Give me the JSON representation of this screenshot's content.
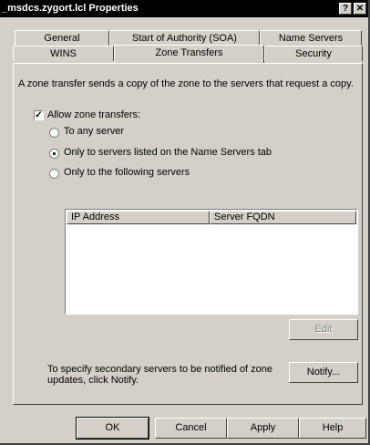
{
  "window": {
    "title": "_msdcs.zygort.lcl Properties",
    "help_label": "?",
    "close_label": "✕"
  },
  "tabs": {
    "row1": [
      "General",
      "Start of Authority (SOA)",
      "Name Servers"
    ],
    "row2": [
      "WINS",
      "Zone Transfers",
      "Security"
    ],
    "active": "Zone Transfers"
  },
  "panel": {
    "description": "A zone transfer sends a copy of the zone to the servers that request a copy.",
    "allow_checkbox_label": "Allow zone transfers:",
    "allow_checked": true,
    "radio_any": "To any server",
    "radio_name_servers": "Only to servers listed on the Name Servers tab",
    "radio_following": "Only to the following servers",
    "selected_radio": "radio_name_servers",
    "list_columns": [
      "IP Address",
      "Server FQDN"
    ],
    "edit_label": "Edit",
    "notify_text_line1": "To specify secondary servers to be notified of zone",
    "notify_text_line2": "updates, click Notify.",
    "notify_label": "Notify..."
  },
  "footer": {
    "ok_label": "OK",
    "cancel_label": "Cancel",
    "apply_label": "Apply",
    "help_label": "Help"
  }
}
